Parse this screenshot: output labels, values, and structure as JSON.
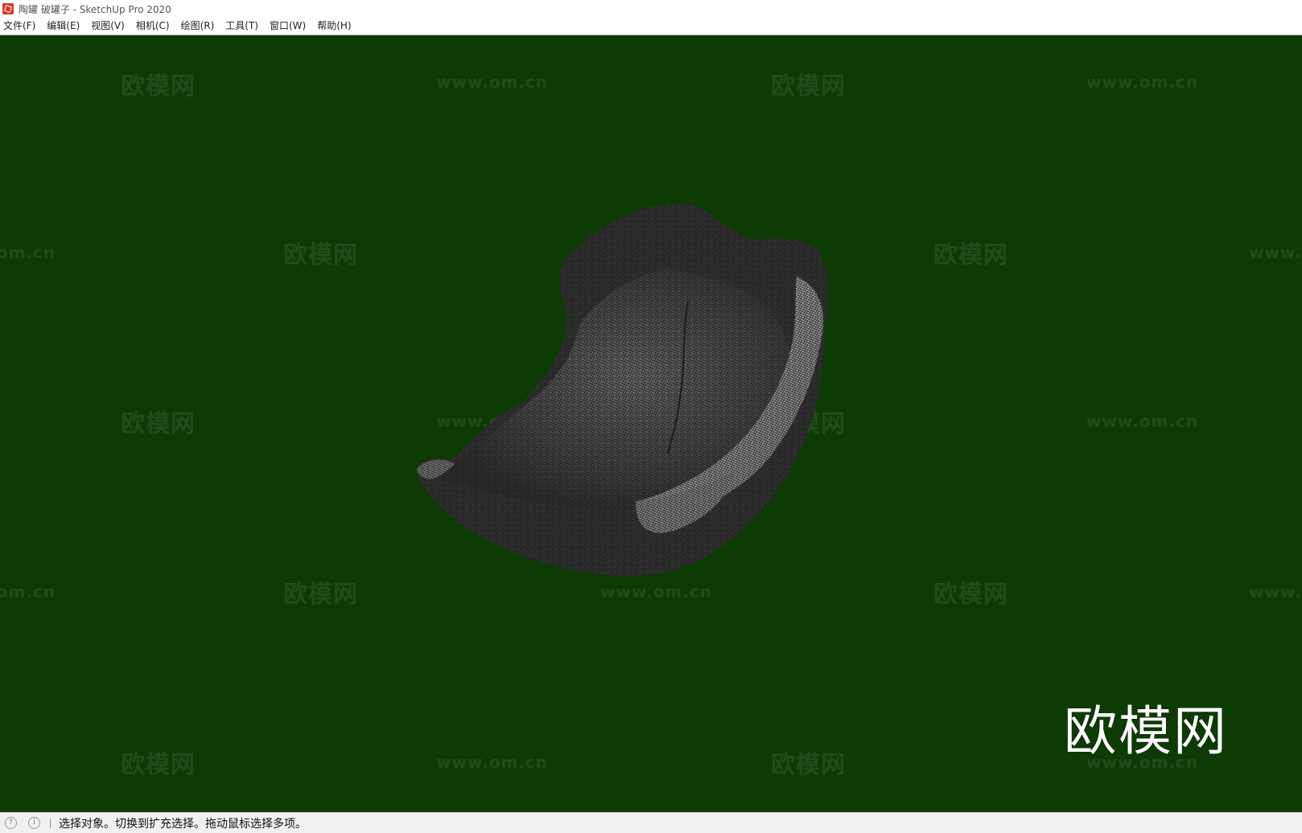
{
  "window": {
    "title": "陶罐 破罐子 - SketchUp Pro 2020",
    "icon": "sketchup-logo-icon"
  },
  "menubar": {
    "items": [
      {
        "label": "文件(F)"
      },
      {
        "label": "编辑(E)"
      },
      {
        "label": "视图(V)"
      },
      {
        "label": "相机(C)"
      },
      {
        "label": "绘图(R)"
      },
      {
        "label": "工具(T)"
      },
      {
        "label": "窗口(W)"
      },
      {
        "label": "帮助(H)"
      }
    ]
  },
  "viewport": {
    "background_color": "#0c3b03",
    "model": "broken-pottery-jar-mesh",
    "watermark_cn": "欧模网",
    "watermark_url": "www.om.cn",
    "logo_text": "欧模网"
  },
  "statusbar": {
    "icons": [
      "geo-location-icon",
      "info-icon"
    ],
    "message": "选择对象。切换到扩充选择。拖动鼠标选择多项。"
  }
}
